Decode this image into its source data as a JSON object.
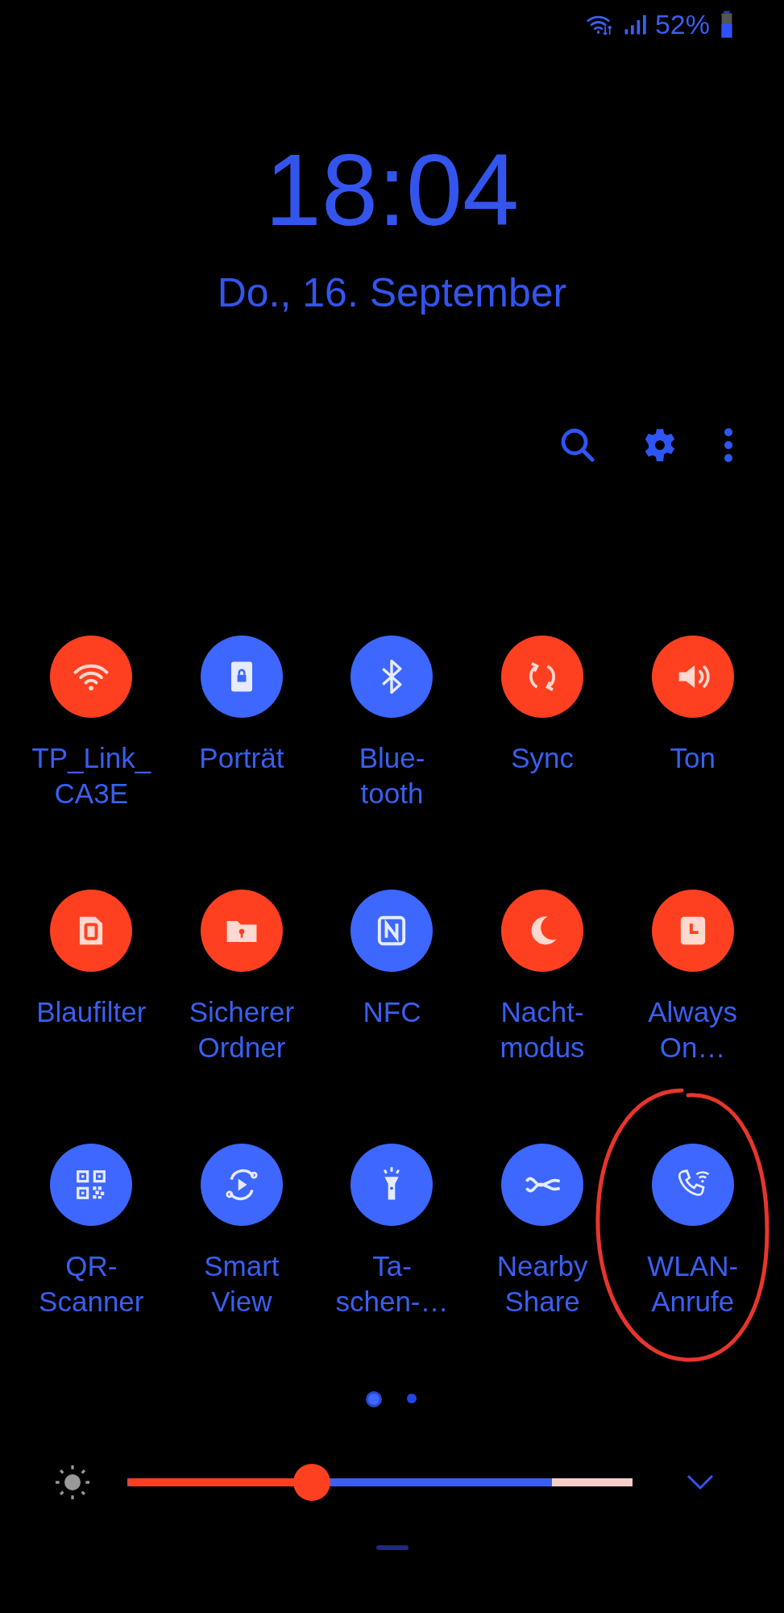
{
  "status_bar": {
    "battery_text": "52%"
  },
  "clock": {
    "time": "18:04",
    "date": "Do., 16. September"
  },
  "tiles": [
    {
      "label": "TP_Link_\nCA3E",
      "on": true,
      "circled": false
    },
    {
      "label": "Porträt",
      "on": false,
      "circled": false
    },
    {
      "label": "Blue-\ntooth",
      "on": false,
      "circled": false
    },
    {
      "label": "Sync",
      "on": true,
      "circled": false
    },
    {
      "label": "Ton",
      "on": true,
      "circled": false
    },
    {
      "label": "Blaufilter",
      "on": true,
      "circled": false
    },
    {
      "label": "Sicherer\nOrdner",
      "on": true,
      "circled": false
    },
    {
      "label": "NFC",
      "on": false,
      "circled": false
    },
    {
      "label": "Nacht-\nmodus",
      "on": true,
      "circled": false
    },
    {
      "label": "Always\nOn…",
      "on": true,
      "circled": false
    },
    {
      "label": "QR-\nScanner",
      "on": false,
      "circled": false
    },
    {
      "label": "Smart\nView",
      "on": false,
      "circled": false
    },
    {
      "label": "Ta-\nschen-…",
      "on": false,
      "circled": false
    },
    {
      "label": "Nearby\nShare",
      "on": false,
      "circled": false
    },
    {
      "label": "WLAN-\nAnrufe",
      "on": false,
      "circled": true
    }
  ],
  "pages": [
    {
      "selected": true
    },
    {
      "selected": false
    }
  ],
  "brightness": {
    "level": 0.365
  }
}
